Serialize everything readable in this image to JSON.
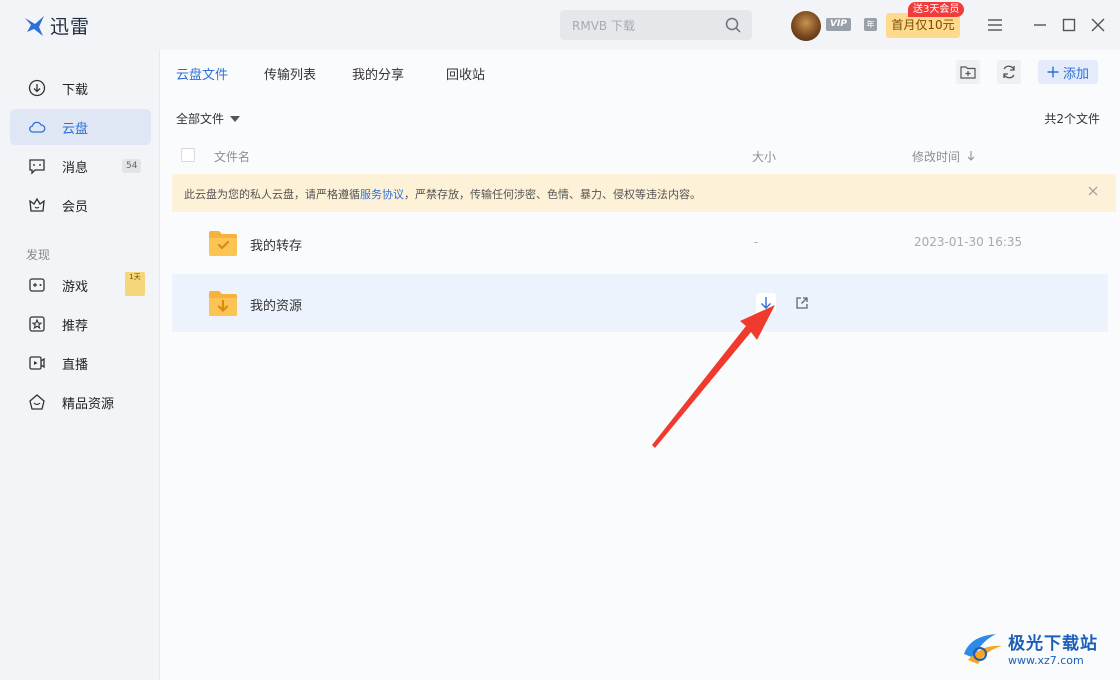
{
  "app": {
    "name": "迅雷"
  },
  "search": {
    "placeholder": "RMVB 下载"
  },
  "account": {
    "vip_label": "VIP",
    "year_label": "年",
    "promo_label": "首月仅10元",
    "promo_tag": "送3天会员"
  },
  "sidebar": {
    "items": [
      {
        "label": "下载",
        "icon": "download-circle-icon"
      },
      {
        "label": "云盘",
        "icon": "cloud-icon",
        "active": true
      },
      {
        "label": "消息",
        "icon": "message-icon",
        "count": "54"
      },
      {
        "label": "会员",
        "icon": "crown-icon"
      }
    ],
    "discover_title": "发现",
    "discover": [
      {
        "label": "游戏",
        "icon": "gamepad-icon",
        "badge": "1天"
      },
      {
        "label": "推荐",
        "icon": "star-icon"
      },
      {
        "label": "直播",
        "icon": "live-video-icon"
      },
      {
        "label": "精品资源",
        "icon": "gem-icon"
      }
    ]
  },
  "tabs": [
    {
      "label": "云盘文件",
      "active": true
    },
    {
      "label": "传输列表"
    },
    {
      "label": "我的分享"
    },
    {
      "label": "回收站"
    }
  ],
  "toolbar": {
    "add_label": "添加"
  },
  "filter": {
    "label": "全部文件",
    "total": "共2个文件"
  },
  "table": {
    "col_name": "文件名",
    "col_size": "大小",
    "col_time": "修改时间"
  },
  "notice": {
    "before": "此云盘为您的私人云盘，请严格遵循",
    "link": "服务协议",
    "after": "，严禁存放，传输任何涉密、色情、暴力、侵权等违法内容。"
  },
  "files": [
    {
      "name": "我的转存",
      "size": "-",
      "time": "2023-01-30 16:35"
    },
    {
      "name": "我的资源",
      "size": "",
      "time": ""
    }
  ],
  "watermark": {
    "title": "极光下载站",
    "url": "www.xz7.com"
  },
  "colors": {
    "accent": "#2e6fda",
    "folder": "#f7b23b",
    "notice_bg": "#fdf1d7",
    "arrow": "#f03a2e"
  }
}
